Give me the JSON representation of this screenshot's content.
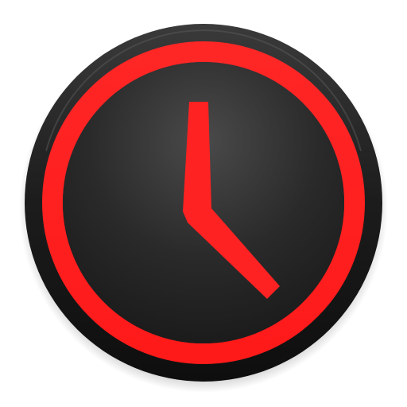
{
  "icon": {
    "name": "clock-icon",
    "colors": {
      "accent": "#ff2222",
      "body_dark": "#161616",
      "face_light": "#4a4a4a",
      "face_dark": "#1b1b1b",
      "background": "#ffffff"
    }
  }
}
